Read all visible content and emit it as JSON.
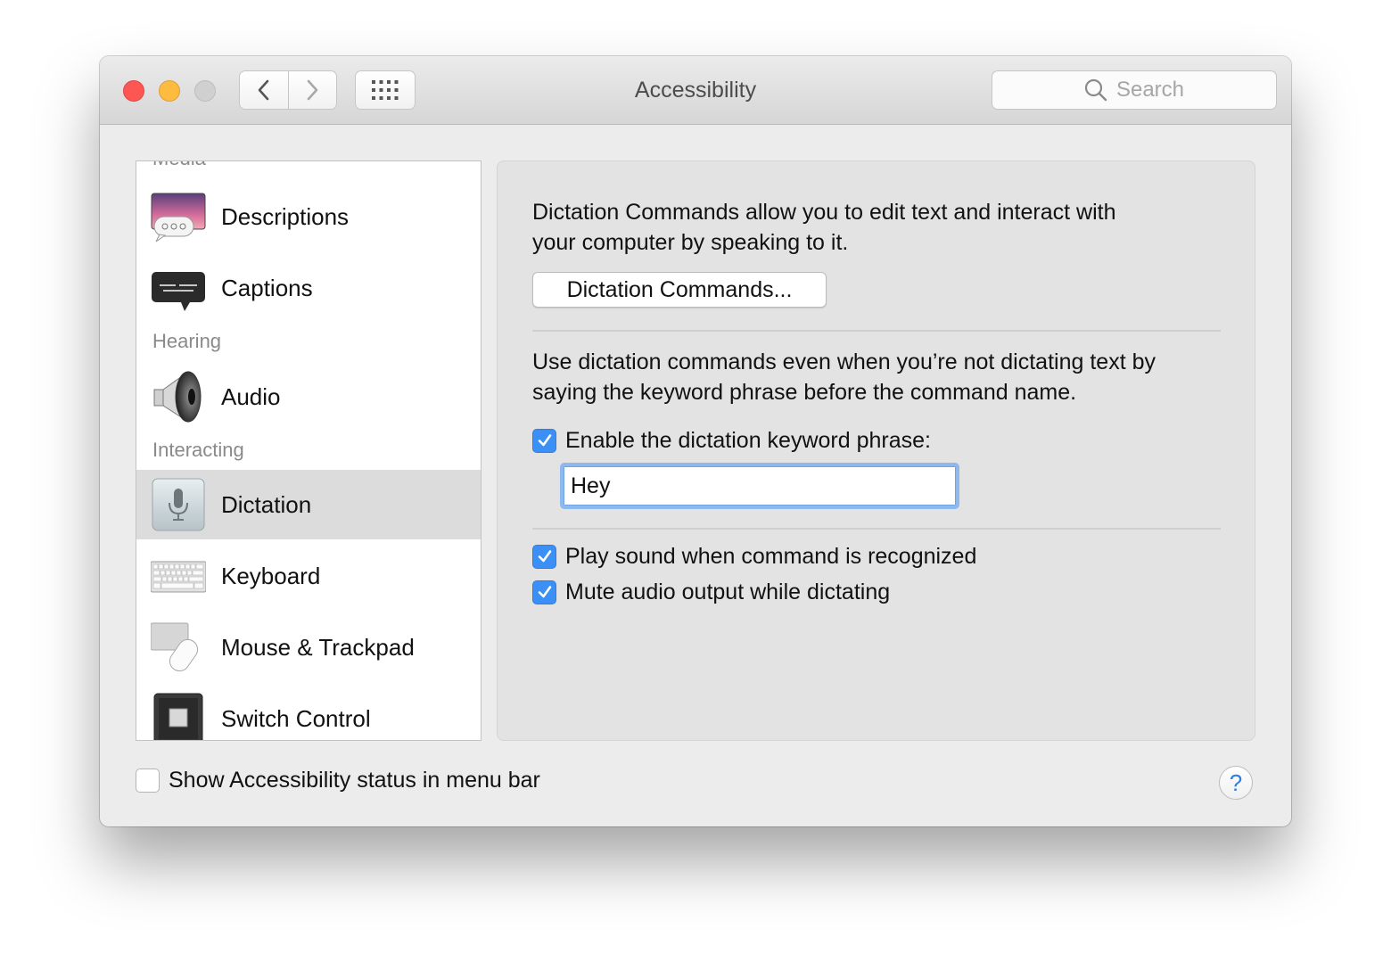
{
  "window": {
    "title": "Accessibility",
    "search_placeholder": "Search"
  },
  "sidebar": {
    "cut_section": "Media",
    "items": [
      {
        "label": "Descriptions",
        "icon": "descriptions-icon"
      },
      {
        "label": "Captions",
        "icon": "captions-icon"
      },
      {
        "label": "Audio",
        "icon": "speaker-icon"
      },
      {
        "label": "Dictation",
        "icon": "microphone-icon",
        "selected": true
      },
      {
        "label": "Keyboard",
        "icon": "keyboard-icon"
      },
      {
        "label": "Mouse & Trackpad",
        "icon": "mouse-trackpad-icon"
      },
      {
        "label": "Switch Control",
        "icon": "switch-control-icon"
      }
    ],
    "sections": {
      "hearing": "Hearing",
      "interacting": "Interacting"
    }
  },
  "pane": {
    "intro_line1": "Dictation Commands allow you to edit text and interact with",
    "intro_line2": "your computer by speaking to it.",
    "commands_button": "Dictation Commands...",
    "keyword_line1": "Use dictation commands even when you’re not dictating text by",
    "keyword_line2": "saying the keyword phrase before the command name.",
    "enable_keyword_label": "Enable the dictation keyword phrase:",
    "enable_keyword_checked": true,
    "keyword_value": "Hey",
    "play_sound_label": "Play sound when command is recognized",
    "play_sound_checked": true,
    "mute_audio_label": "Mute audio output while dictating",
    "mute_audio_checked": true
  },
  "footer": {
    "show_status_label": "Show Accessibility status in menu bar",
    "show_status_checked": false,
    "help_label": "?"
  },
  "colors": {
    "accent": "#3b8ff5",
    "close": "#fc5753",
    "minimize": "#fdbc40",
    "zoom_disabled": "#d0d0d0"
  }
}
